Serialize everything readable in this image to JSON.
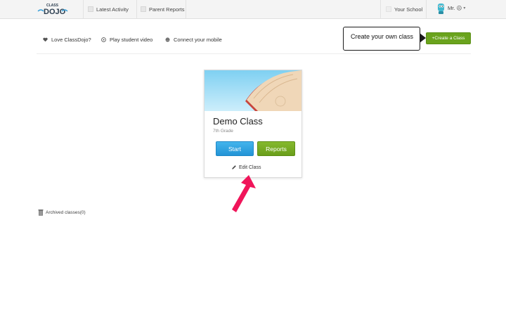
{
  "nav": {
    "logo_top": "CLASS",
    "logo_main": "DOJO",
    "latest_activity": "Latest Activity",
    "parent_reports": "Parent Reports",
    "your_school": "Your School",
    "user_name": "Mr. ☹",
    "user_caret": "▾"
  },
  "toolbar": {
    "love": "Love ClassDojo?",
    "video": "Play student video",
    "mobile": "Connect your mobile",
    "callout": "Create your own class",
    "create_button": "+Create a Class"
  },
  "card": {
    "title": "Demo Class",
    "subtitle": "7th Grade",
    "start_label": "Start",
    "reports_label": "Reports",
    "edit_label": "Edit Class"
  },
  "archived": "Archived classes(0)",
  "colors": {
    "green": "#6aa31d",
    "blue": "#2394d6",
    "annotation_arrow": "#f0155a"
  }
}
